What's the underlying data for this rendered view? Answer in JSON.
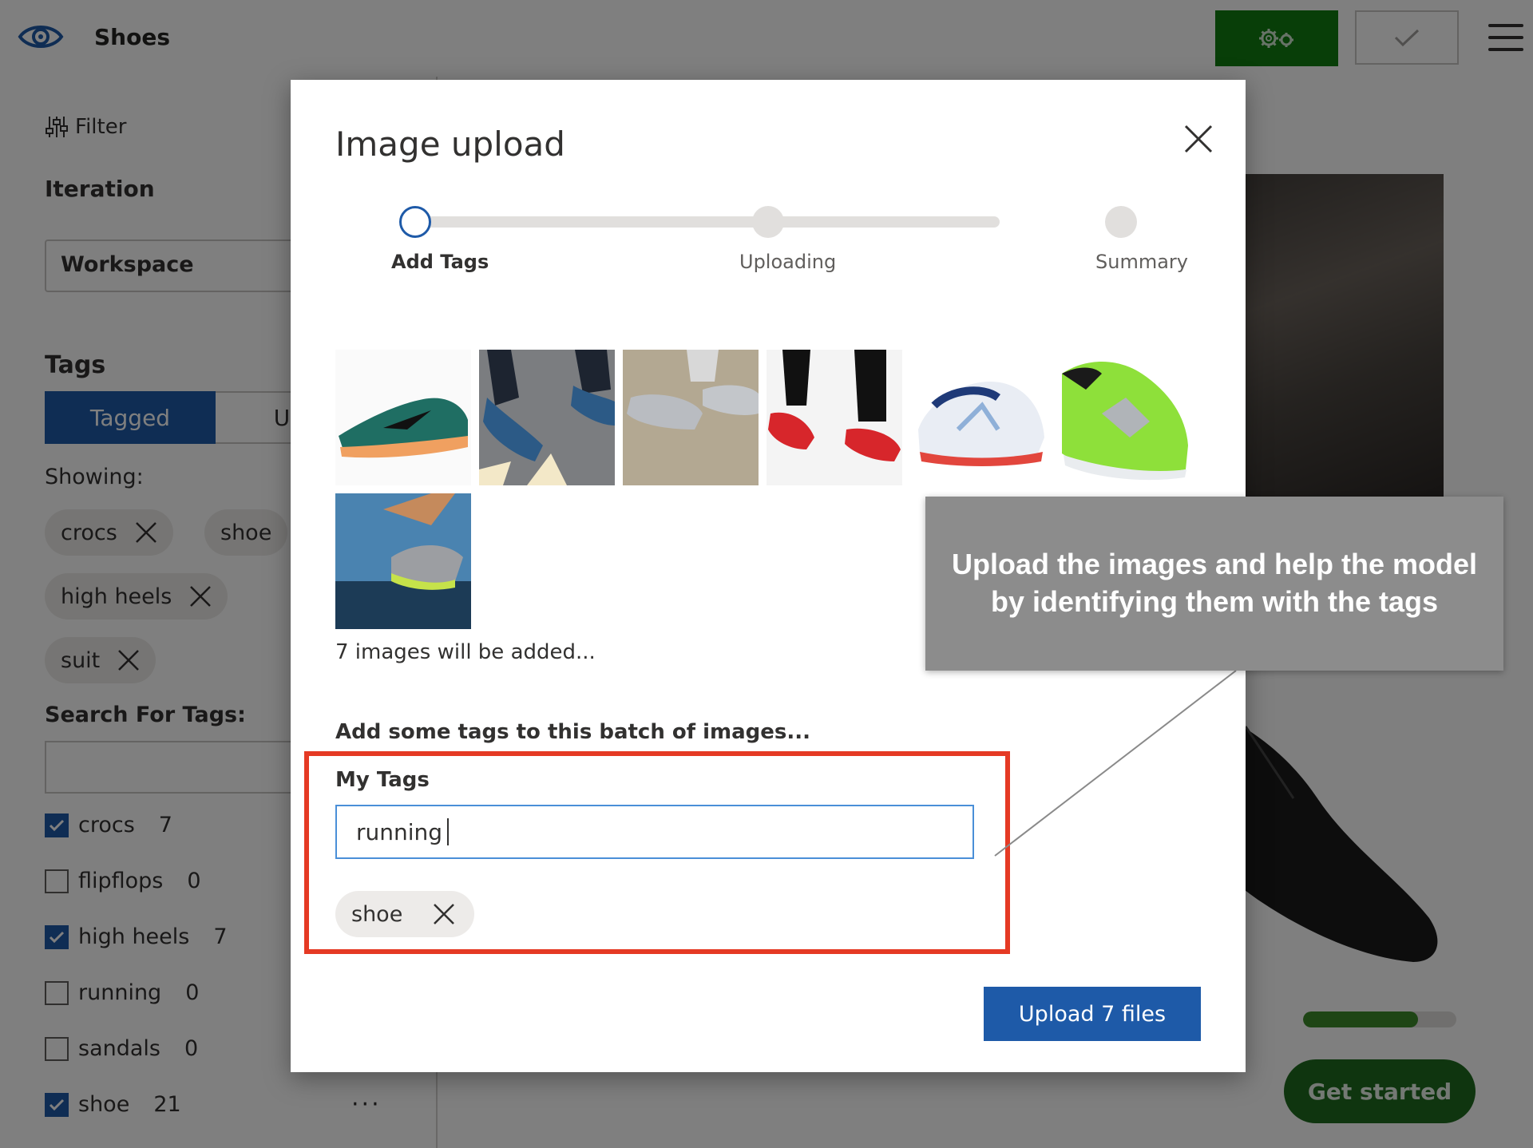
{
  "app": {
    "title": "Shoes"
  },
  "sidebar": {
    "filter_label": "Filter",
    "iteration_heading": "Iteration",
    "iteration_value": "Workspace",
    "tags_heading": "Tags",
    "tabs": [
      {
        "label": "Tagged",
        "active": true
      },
      {
        "label": "Unta",
        "active": false
      }
    ],
    "showing_label": "Showing:",
    "showing_chips": [
      "crocs",
      "shoe",
      "high heels",
      "suit"
    ],
    "search_heading": "Search For Tags:",
    "search_value": "",
    "tag_list": [
      {
        "name": "crocs",
        "count": "7",
        "checked": true
      },
      {
        "name": "flipflops",
        "count": "0",
        "checked": false
      },
      {
        "name": "high heels",
        "count": "7",
        "checked": true
      },
      {
        "name": "running",
        "count": "0",
        "checked": false
      },
      {
        "name": "sandals",
        "count": "0",
        "checked": false
      },
      {
        "name": "shoe",
        "count": "21",
        "checked": true
      }
    ],
    "more_label": "···"
  },
  "main": {
    "get_started_label": "Get started",
    "training_progress_fraction": 0.75
  },
  "modal": {
    "title": "Image upload",
    "steps": [
      {
        "label": "Add Tags",
        "state": "current"
      },
      {
        "label": "Uploading",
        "state": "pending"
      },
      {
        "label": "Summary",
        "state": "pending"
      }
    ],
    "images_note": "7 images will be added...",
    "batch_heading": "Add some tags to this batch of images...",
    "my_tags_label": "My Tags",
    "tag_input_value": "running",
    "added_tags": [
      "shoe"
    ],
    "upload_button_label": "Upload 7 files"
  },
  "callout": {
    "text": "Upload the images and help the model by identifying them with the tags"
  },
  "colors": {
    "accent": "#1e5aa8",
    "train_green": "#107c10",
    "highlight_red": "#e53a24",
    "callout_gray": "#8c8c8c"
  },
  "icons": [
    "eye-logo-icon",
    "gears-icon",
    "checkmark-icon",
    "hamburger-menu-icon",
    "filter-sliders-icon",
    "close-icon",
    "remove-tag-icon"
  ]
}
